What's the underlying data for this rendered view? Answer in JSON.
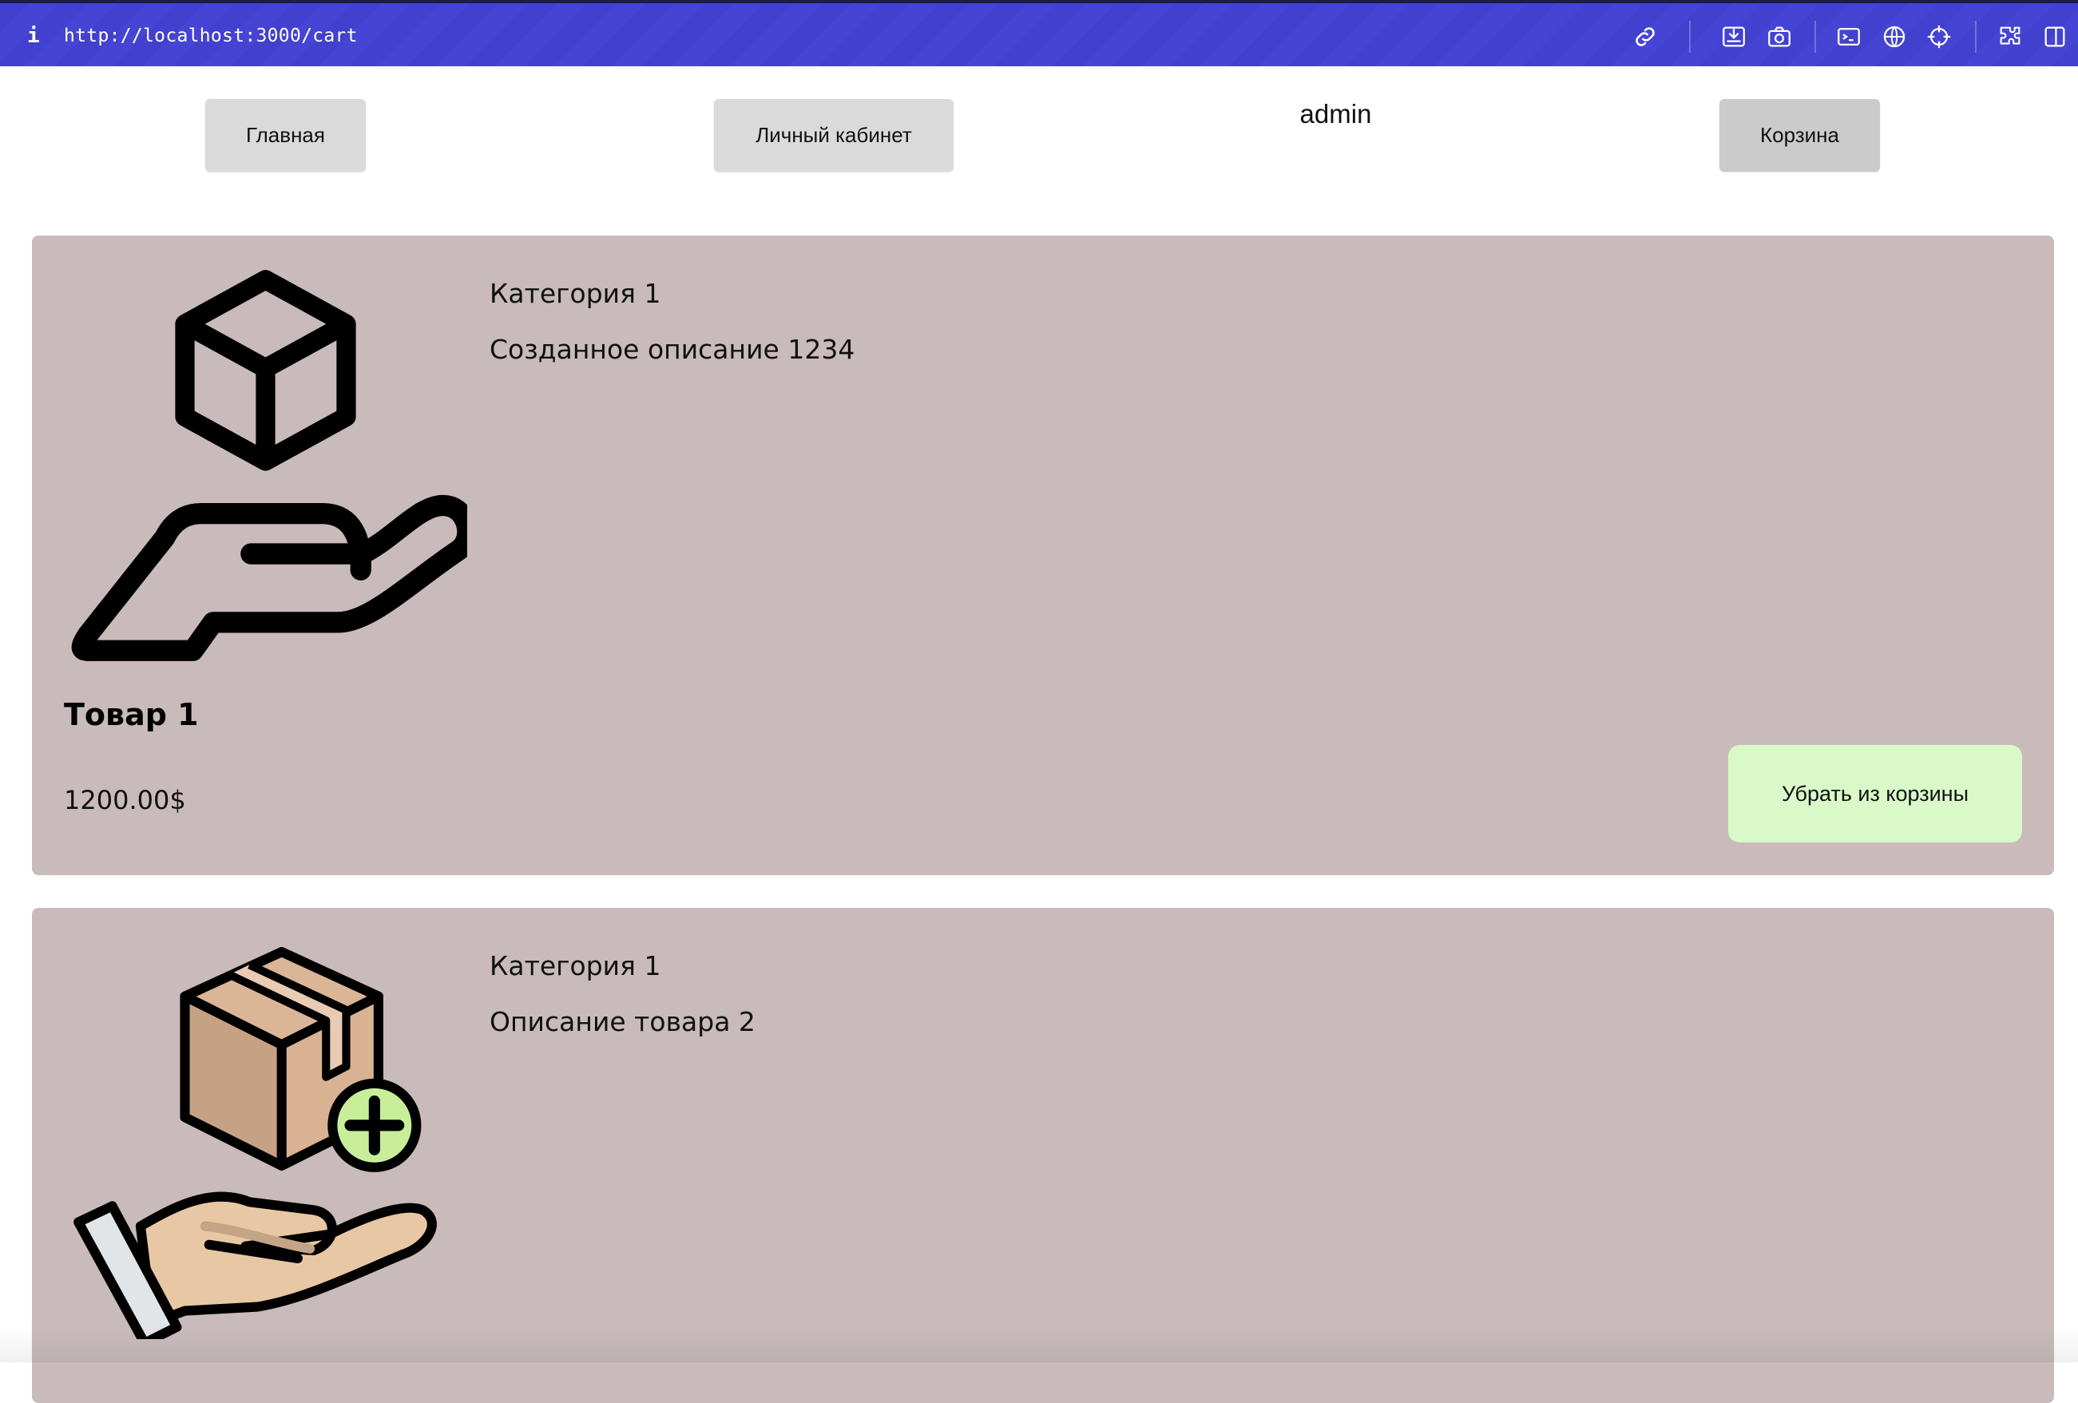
{
  "browser": {
    "url": "http://localhost:3000/cart",
    "icons": [
      "info-icon",
      "link-icon",
      "save-icon",
      "camera-icon",
      "terminal-icon",
      "globe-icon",
      "crosshair-icon",
      "extensions-icon",
      "sidebar-icon"
    ]
  },
  "nav": {
    "home_label": "Главная",
    "account_label": "Личный кабинет",
    "username": "admin",
    "cart_label": "Корзина"
  },
  "cart": {
    "items": [
      {
        "category": "Категория 1",
        "description": "Созданное описание 1234",
        "title": "Товар 1",
        "price": "1200.00$",
        "remove_label": "Убрать из корзины",
        "image_icon": "hand-box-outline-icon"
      },
      {
        "category": "Категория 1",
        "description": "Описание товара 2",
        "image_icon": "hand-box-add-icon"
      }
    ]
  },
  "colors": {
    "toolbar": "#4240cf",
    "card_background": "#c9bbbb",
    "remove_button": "#daf9c9",
    "nav_button": "#dadada"
  }
}
